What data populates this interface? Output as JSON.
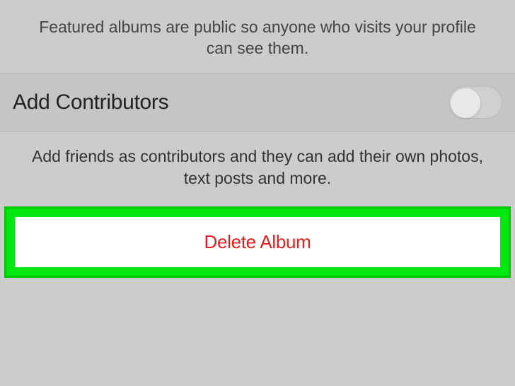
{
  "featured": {
    "description": "Featured albums are public so anyone who visits your profile can see them."
  },
  "contributors": {
    "label": "Add Contributors",
    "toggle_state": "off",
    "description": "Add friends as contributors and they can add their own photos, text posts and more."
  },
  "delete": {
    "label": "Delete Album"
  }
}
